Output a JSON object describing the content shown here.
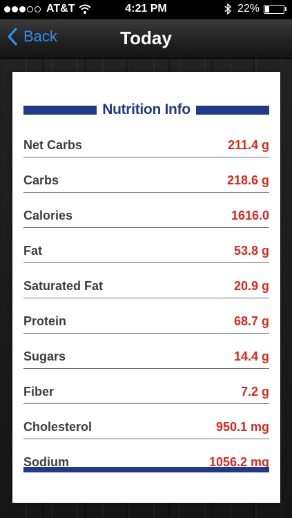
{
  "status_bar": {
    "carrier": "AT&T",
    "time": "4:21 PM",
    "battery_percent": "22%",
    "battery_level": 0.22,
    "signal_bars_filled": 3,
    "signal_bars_total": 5
  },
  "nav": {
    "back_label": "Back",
    "title": "Today"
  },
  "card": {
    "title": "Nutrition Info",
    "accent_color": "#1f3a8a",
    "value_color": "#e1251b",
    "rows": [
      {
        "label": "Net Carbs",
        "value": "211.4 g"
      },
      {
        "label": "Carbs",
        "value": "218.6 g"
      },
      {
        "label": "Calories",
        "value": "1616.0"
      },
      {
        "label": "Fat",
        "value": "53.8 g"
      },
      {
        "label": "Saturated Fat",
        "value": "20.9 g"
      },
      {
        "label": "Protein",
        "value": "68.7 g"
      },
      {
        "label": "Sugars",
        "value": "14.4 g"
      },
      {
        "label": "Fiber",
        "value": "7.2 g"
      },
      {
        "label": "Cholesterol",
        "value": "950.1 mg"
      },
      {
        "label": "Sodium",
        "value": "1056.2 mg"
      }
    ]
  }
}
